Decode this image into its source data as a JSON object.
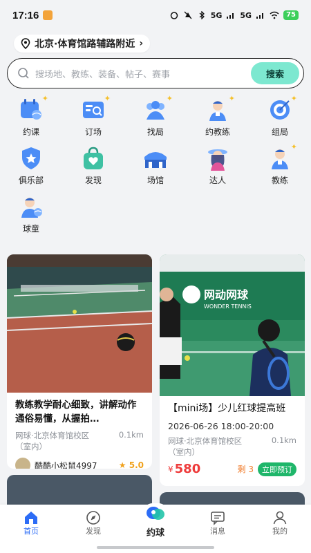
{
  "status_bar": {
    "time": "17:16",
    "battery": "75",
    "signal_1": "5G",
    "signal_2": "5G"
  },
  "location": {
    "text": "北京·体育馆路辅路附近",
    "chevron": "›"
  },
  "search": {
    "placeholder": "搜场地、教练、装备、帖子、赛事",
    "button_label": "搜索"
  },
  "categories": [
    {
      "label": "约课",
      "icon": "calendar-ball-icon"
    },
    {
      "label": "订场",
      "icon": "court-booking-icon"
    },
    {
      "label": "找局",
      "icon": "group-people-icon"
    },
    {
      "label": "约教练",
      "icon": "coach-icon"
    },
    {
      "label": "组局",
      "icon": "target-icon"
    },
    {
      "label": "俱乐部",
      "icon": "shield-star-icon"
    },
    {
      "label": "发现",
      "icon": "bag-heart-icon"
    },
    {
      "label": "场馆",
      "icon": "stadium-icon"
    },
    {
      "label": "达人",
      "icon": "influencer-icon"
    },
    {
      "label": "教练",
      "icon": "coach-icon"
    },
    {
      "label": "球童",
      "icon": "ball-kid-icon"
    }
  ],
  "feed": {
    "left_card": {
      "title": "教练教学耐心细致，讲解动作通俗易懂，从握拍…",
      "venue": "网球·北京体育馆校区",
      "venue_sub": "（室内）",
      "distance": "0.1km",
      "user_name": "酷酷小松鼠4997",
      "rating": "5.0"
    },
    "right_card": {
      "banner_text": "网动网球",
      "banner_sub": "WONDER TENNIS",
      "title": "【mini场】少儿红球提高班",
      "datetime": "2026-06-26 18:00-20:00",
      "venue": "网球·北京体育馆校区",
      "venue_sub": "（室内）",
      "distance": "0.1km",
      "price_symbol": "¥",
      "price": "580",
      "remain": "剩 3",
      "book_label": "立即预订"
    }
  },
  "bottom_nav": {
    "home": "首页",
    "discover": "发现",
    "center": "约球",
    "messages": "消息",
    "mine": "我的"
  },
  "colors": {
    "accent_blue": "#2c6cf6",
    "search_button": "#7de8d0",
    "price_red": "#ee3b3b",
    "book_green": "#1fb66a"
  }
}
